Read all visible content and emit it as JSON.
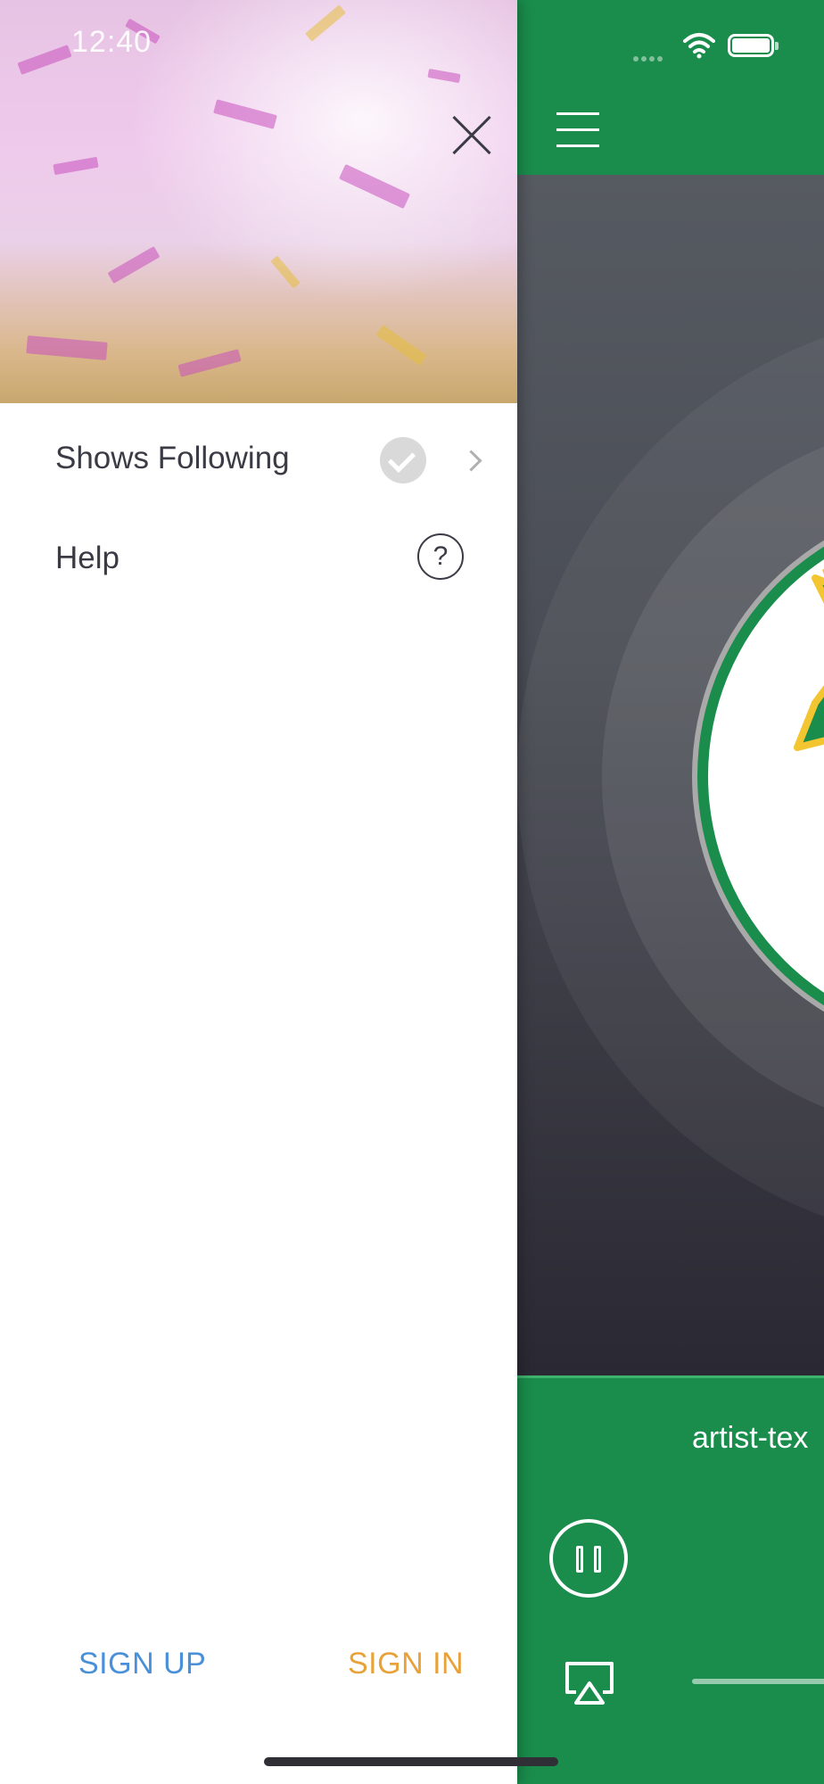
{
  "status_bar": {
    "time": "12:40"
  },
  "drawer": {
    "menu_items": [
      {
        "label": "Shows Following"
      },
      {
        "label": "Help"
      }
    ],
    "help_icon_glyph": "?",
    "sign_up_label": "SIGN UP",
    "sign_in_label": "SIGN IN",
    "colors": {
      "sign_up": "#4a90d9",
      "sign_in": "#e8a23a",
      "text": "#3b3b45"
    }
  },
  "player": {
    "track_title": "artist-tex",
    "colors": {
      "brand_green": "#1a8d4c"
    }
  },
  "icons": [
    "close-icon",
    "check-icon",
    "chevron-right-icon",
    "help-icon",
    "hamburger-icon",
    "pause-icon",
    "airplay-icon",
    "wifi-icon",
    "battery-icon"
  ]
}
